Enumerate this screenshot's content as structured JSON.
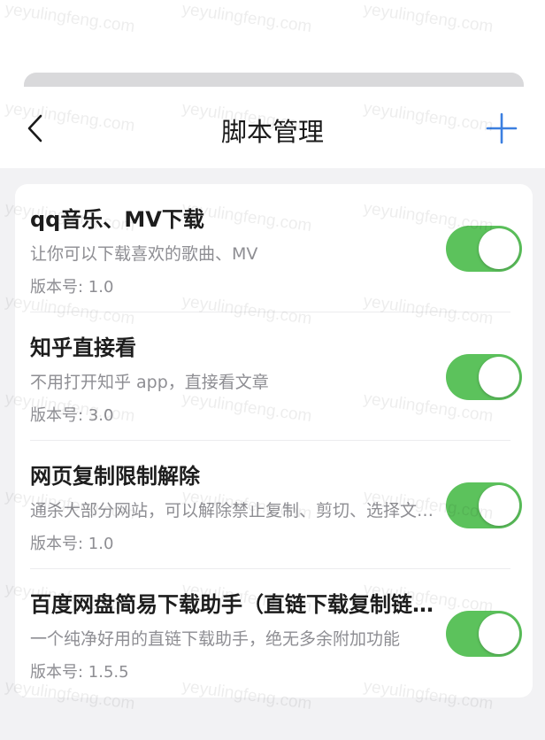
{
  "header": {
    "title": "脚本管理",
    "back_icon": "chevron-left-icon",
    "add_icon": "plus-icon"
  },
  "colors": {
    "accent": "#3b7fe0",
    "toggle_on": "#5cc25c",
    "background": "#f2f2f4"
  },
  "scripts": [
    {
      "name": "qq音乐、MV下载",
      "description": "让你可以下载喜欢的歌曲、MV",
      "version": "版本号: 1.0",
      "enabled": true
    },
    {
      "name": "知乎直接看",
      "description": "不用打开知乎 app，直接看文章",
      "version": "版本号: 3.0",
      "enabled": true
    },
    {
      "name": "网页复制限制解除",
      "description": "通杀大部分网站，可以解除禁止复制、剪切、选择文本、右键菜单的限制",
      "version": "版本号: 1.0",
      "enabled": true
    },
    {
      "name": "百度网盘简易下载助手（直链下载复制链接）",
      "description": "一个纯净好用的直链下载助手，绝无多余附加功能",
      "version": "版本号: 1.5.5",
      "enabled": true
    }
  ],
  "watermark": "yeyulingfeng.com"
}
